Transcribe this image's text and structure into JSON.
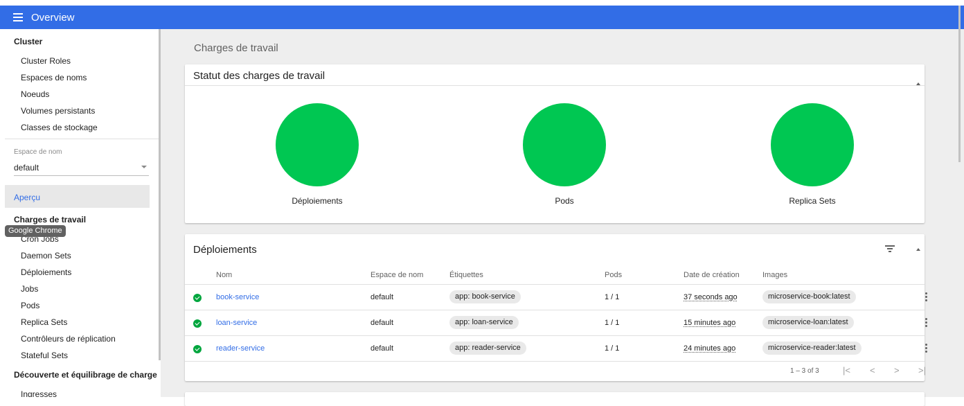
{
  "topbar": {
    "title": "Overview",
    "menu_icon": "menu-icon",
    "color": "#326de6"
  },
  "sidebar": {
    "cluster_header": "Cluster",
    "cluster_items": [
      "Cluster Roles",
      "Espaces de noms",
      "Noeuds",
      "Volumes persistants",
      "Classes de stockage"
    ],
    "namespace_label": "Espace de nom",
    "namespace_value": "default",
    "overview_item": "Aperçu",
    "workloads_header": "Charges de travail",
    "workloads_items": [
      "Cron Jobs",
      "Daemon Sets",
      "Déploiements",
      "Jobs",
      "Pods",
      "Replica Sets",
      "Contrôleurs de réplication",
      "Stateful Sets"
    ],
    "discovery_header": "Découverte et équilibrage de charge",
    "discovery_items": [
      "Ingresses"
    ]
  },
  "tooltip": "Google Chrome",
  "main": {
    "page_title": "Charges de travail",
    "status_card": {
      "title": "Statut des charges de travail",
      "items": [
        {
          "label": "Déploiements",
          "status": "running",
          "color": "#00c752"
        },
        {
          "label": "Pods",
          "status": "running",
          "color": "#00c752"
        },
        {
          "label": "Replica Sets",
          "status": "running",
          "color": "#00c752"
        }
      ]
    },
    "deployments_card": {
      "title": "Déploiements",
      "columns": [
        "Nom",
        "Espace de nom",
        "Étiquettes",
        "Pods",
        "Date de création",
        "Images"
      ],
      "rows": [
        {
          "name": "book-service",
          "namespace": "default",
          "label": "app: book-service",
          "pods": "1 / 1",
          "created": "37 seconds ago",
          "image": "microservice-book:latest"
        },
        {
          "name": "loan-service",
          "namespace": "default",
          "label": "app: loan-service",
          "pods": "1 / 1",
          "created": "15 minutes ago",
          "image": "microservice-loan:latest"
        },
        {
          "name": "reader-service",
          "namespace": "default",
          "label": "app: reader-service",
          "pods": "1 / 1",
          "created": "24 minutes ago",
          "image": "microservice-reader:latest"
        }
      ],
      "pagination": {
        "range": "1 – 3 of 3",
        "first": "|<",
        "prev": "<",
        "next": ">",
        "last": ">|"
      }
    }
  }
}
